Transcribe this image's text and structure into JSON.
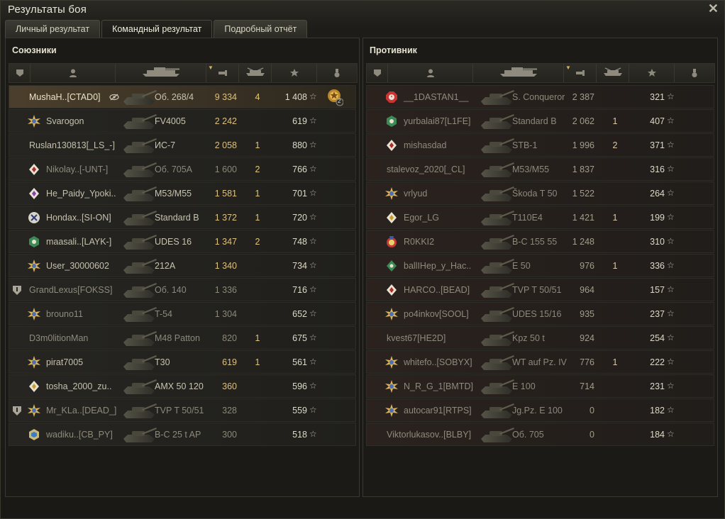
{
  "window": {
    "title": "Результаты боя",
    "close_label": "✕"
  },
  "tabs": [
    {
      "label": "Личный результат",
      "active": false
    },
    {
      "label": "Командный результат",
      "active": true
    },
    {
      "label": "Подробный отчёт",
      "active": false
    }
  ],
  "allies": {
    "title": "Союзники",
    "rows": [
      {
        "name": "MushaH..[CTAD0]",
        "tank": "Об. 268/4",
        "damage": "9 334",
        "kills": "4",
        "xp": "1 408",
        "badge": "none",
        "me": true,
        "dead": false,
        "damage_style": "gold",
        "medal": "mastery-medal",
        "medal_count": "2",
        "crossed_eye": true
      },
      {
        "name": "Svarogon",
        "tank": "FV4005",
        "damage": "2 242",
        "kills": "",
        "xp": "619",
        "badge": "star-gold",
        "me": false,
        "dead": false,
        "damage_style": "gold"
      },
      {
        "name": "Ruslan130813[_LS_-]",
        "tank": "ИС-7",
        "damage": "2 058",
        "kills": "1",
        "xp": "880",
        "badge": "none",
        "me": false,
        "dead": false,
        "damage_style": "gold"
      },
      {
        "name": "Nikolay..[-UNT-]",
        "tank": "Об. 705А",
        "damage": "1 600",
        "kills": "2",
        "xp": "766",
        "badge": "diamond-red",
        "me": false,
        "dead": true,
        "damage_style": "dim"
      },
      {
        "name": "He_Paidy_Ypoki..",
        "tank": "M53/M55",
        "damage": "1 581",
        "kills": "1",
        "xp": "701",
        "badge": "diamond-purple",
        "me": false,
        "dead": false,
        "damage_style": "gold"
      },
      {
        "name": "Hondax..[SI-ON]",
        "tank": "Standard B",
        "damage": "1 372",
        "kills": "1",
        "xp": "720",
        "badge": "x-blue",
        "me": false,
        "dead": false,
        "damage_style": "gold"
      },
      {
        "name": "maasali..[LAYK-]",
        "tank": "UDES 16",
        "damage": "1 347",
        "kills": "2",
        "xp": "748",
        "badge": "green-hex",
        "me": false,
        "dead": false,
        "damage_style": "gold"
      },
      {
        "name": "User_30000602",
        "tank": "212A",
        "damage": "1 340",
        "kills": "",
        "xp": "734",
        "badge": "star-gold",
        "me": false,
        "dead": false,
        "damage_style": "gold"
      },
      {
        "name": "GrandLexus[FOKSS]",
        "tank": "Об. 140",
        "damage": "1 336",
        "kills": "",
        "xp": "716",
        "badge": "none",
        "me": false,
        "dead": true,
        "damage_style": "dim",
        "clan_shield": true
      },
      {
        "name": "brouno11",
        "tank": "T-54",
        "damage": "1 304",
        "kills": "",
        "xp": "652",
        "badge": "star-gold",
        "me": false,
        "dead": true,
        "damage_style": "dim"
      },
      {
        "name": "D3m0litionMan",
        "tank": "M48 Patton",
        "damage": "820",
        "kills": "1",
        "xp": "675",
        "badge": "none",
        "me": false,
        "dead": true,
        "damage_style": "dim"
      },
      {
        "name": "pirat7005",
        "tank": "T30",
        "damage": "619",
        "kills": "1",
        "xp": "561",
        "badge": "star-gold",
        "me": false,
        "dead": false,
        "damage_style": "gold"
      },
      {
        "name": "tosha_2000_zu..",
        "tank": "AMX 50 120",
        "damage": "360",
        "kills": "",
        "xp": "596",
        "badge": "diamond-gold",
        "me": false,
        "dead": false,
        "damage_style": "gold"
      },
      {
        "name": "Mr_KLa..[DEAD_]",
        "tank": "TVP T 50/51",
        "damage": "328",
        "kills": "",
        "xp": "559",
        "badge": "star-gold",
        "me": false,
        "dead": true,
        "damage_style": "dim",
        "clan_shield": true
      },
      {
        "name": "wadiku..[CB_PY]",
        "tank": "B-C 25 t AP",
        "damage": "300",
        "kills": "",
        "xp": "518",
        "badge": "cube-blue",
        "me": false,
        "dead": true,
        "damage_style": "dim"
      }
    ]
  },
  "enemies": {
    "title": "Противник",
    "rows": [
      {
        "name": "__1DASTAN1__",
        "tank": "S. Conqueror",
        "damage": "2 387",
        "kills": "",
        "xp": "321",
        "badge": "red-octagon",
        "dead": true
      },
      {
        "name": "yurbalai87[L1FE]",
        "tank": "Standard B",
        "damage": "2 062",
        "kills": "1",
        "xp": "407",
        "badge": "green-hex",
        "dead": true
      },
      {
        "name": "mishasdad",
        "tank": "STB-1",
        "damage": "1 996",
        "kills": "2",
        "xp": "371",
        "badge": "diamond-red",
        "dead": true
      },
      {
        "name": "stalevoz_2020[_CL]",
        "tank": "M53/M55",
        "damage": "1 837",
        "kills": "",
        "xp": "316",
        "badge": "none",
        "dead": true
      },
      {
        "name": "vrlyud",
        "tank": "Škoda T 50",
        "damage": "1 522",
        "kills": "",
        "xp": "264",
        "badge": "star-gold",
        "dead": true
      },
      {
        "name": "Egor_LG",
        "tank": "T110E4",
        "damage": "1 421",
        "kills": "1",
        "xp": "199",
        "badge": "diamond-gold",
        "dead": true
      },
      {
        "name": "R0KKI2",
        "tank": "B-C 155 55",
        "damage": "1 248",
        "kills": "",
        "xp": "310",
        "badge": "medal-red",
        "dead": true
      },
      {
        "name": "ballIHep_y_Hac..",
        "tank": "E 50",
        "damage": "976",
        "kills": "1",
        "xp": "336",
        "badge": "green-diamond",
        "dead": true
      },
      {
        "name": "HARCO..[BEAD]",
        "tank": "TVP T 50/51",
        "damage": "964",
        "kills": "",
        "xp": "157",
        "badge": "diamond-red",
        "dead": true
      },
      {
        "name": "po4inkov[SOOL]",
        "tank": "UDES 15/16",
        "damage": "935",
        "kills": "",
        "xp": "237",
        "badge": "star-gold",
        "dead": true
      },
      {
        "name": "kvest67[HE2D]",
        "tank": "Kpz 50 t",
        "damage": "924",
        "kills": "",
        "xp": "254",
        "badge": "none",
        "dead": true
      },
      {
        "name": "whitefo..[SOBYX]",
        "tank": "WT auf Pz. IV",
        "damage": "776",
        "kills": "1",
        "xp": "222",
        "badge": "star-gold",
        "dead": true
      },
      {
        "name": "N_R_G_1[BMTD]",
        "tank": "E 100",
        "damage": "714",
        "kills": "",
        "xp": "231",
        "badge": "star-gold",
        "dead": true
      },
      {
        "name": "autocar91[RTPS]",
        "tank": "Jg.Pz. E 100",
        "damage": "0",
        "kills": "",
        "xp": "182",
        "badge": "star-gold",
        "dead": true
      },
      {
        "name": "Viktorlukasov..[BLBY]",
        "tank": "Об. 705",
        "damage": "0",
        "kills": "",
        "xp": "184",
        "badge": "none",
        "dead": true
      }
    ]
  },
  "header_icons": [
    "platoon-icon",
    "player-icon",
    "tank-icon",
    "damage-icon",
    "kills-icon",
    "xp-star-icon",
    "medal-icon"
  ],
  "star_glyph": "☆",
  "colors": {
    "gold": "#dcc080",
    "dim": "#8b877a",
    "me_row": "#4b3f2c"
  }
}
